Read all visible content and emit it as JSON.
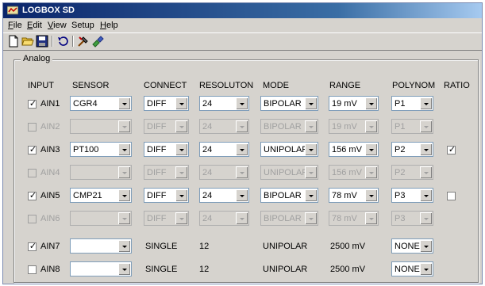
{
  "window": {
    "title": "LOGBOX SD"
  },
  "menu": [
    {
      "label": "File",
      "key": "F",
      "rest": "ile"
    },
    {
      "label": "Edit",
      "key": "E",
      "rest": "dit"
    },
    {
      "label": "View",
      "key": "V",
      "rest": "iew"
    },
    {
      "label": "Setup",
      "key": "",
      "rest": "Setup"
    },
    {
      "label": "Help",
      "key": "H",
      "rest": "elp"
    }
  ],
  "toolbar": {
    "icons": [
      "new-document-icon",
      "open-folder-icon",
      "save-icon",
      "undo-icon",
      "settings-tools-icon",
      "connect-icon"
    ]
  },
  "group": {
    "label": "Analog"
  },
  "headers": {
    "input": "INPUT",
    "sensor": "SENSOR",
    "connect": "CONNECT",
    "resolution": "RESOLUTON",
    "mode": "MODE",
    "range": "RANGE",
    "polynom": "POLYNOM",
    "ratio": "RATIO"
  },
  "rows": [
    {
      "name": "AIN1",
      "checked": true,
      "enabled": true,
      "sensor": "CGR4",
      "connect": "DIFF",
      "resolution": "24",
      "mode": "BIPOLAR",
      "range": "19 mV",
      "polynom": "P1",
      "ratio": null
    },
    {
      "name": "AIN2",
      "checked": false,
      "enabled": false,
      "sensor": "",
      "connect": "DIFF",
      "resolution": "24",
      "mode": "BIPOLAR",
      "range": "19 mV",
      "polynom": "P1",
      "ratio": null
    },
    {
      "name": "AIN3",
      "checked": true,
      "enabled": true,
      "sensor": "PT100",
      "connect": "DIFF",
      "resolution": "24",
      "mode": "UNIPOLAR",
      "range": "156 mV",
      "polynom": "P2",
      "ratio": true
    },
    {
      "name": "AIN4",
      "checked": false,
      "enabled": false,
      "sensor": "",
      "connect": "DIFF",
      "resolution": "24",
      "mode": "UNIPOLAR",
      "range": "156 mV",
      "polynom": "P2",
      "ratio": null
    },
    {
      "name": "AIN5",
      "checked": true,
      "enabled": true,
      "sensor": "CMP21",
      "connect": "DIFF",
      "resolution": "24",
      "mode": "BIPOLAR",
      "range": "78 mV",
      "polynom": "P3",
      "ratio": false
    },
    {
      "name": "AIN6",
      "checked": false,
      "enabled": false,
      "sensor": "",
      "connect": "DIFF",
      "resolution": "24",
      "mode": "BIPOLAR",
      "range": "78 mV",
      "polynom": "P3",
      "ratio": null
    }
  ],
  "single_rows": [
    {
      "name": "AIN7",
      "checked": true,
      "sensor": "",
      "connect": "SINGLE",
      "resolution": "12",
      "mode": "UNIPOLAR",
      "range": "2500 mV",
      "polynom": "NONE"
    },
    {
      "name": "AIN8",
      "checked": false,
      "sensor": "",
      "connect": "SINGLE",
      "resolution": "12",
      "mode": "UNIPOLAR",
      "range": "2500 mV",
      "polynom": "NONE"
    }
  ],
  "colors": {
    "titlebar_start": "#0a246a",
    "titlebar_end": "#a6caf0",
    "face": "#d6d3ce"
  }
}
